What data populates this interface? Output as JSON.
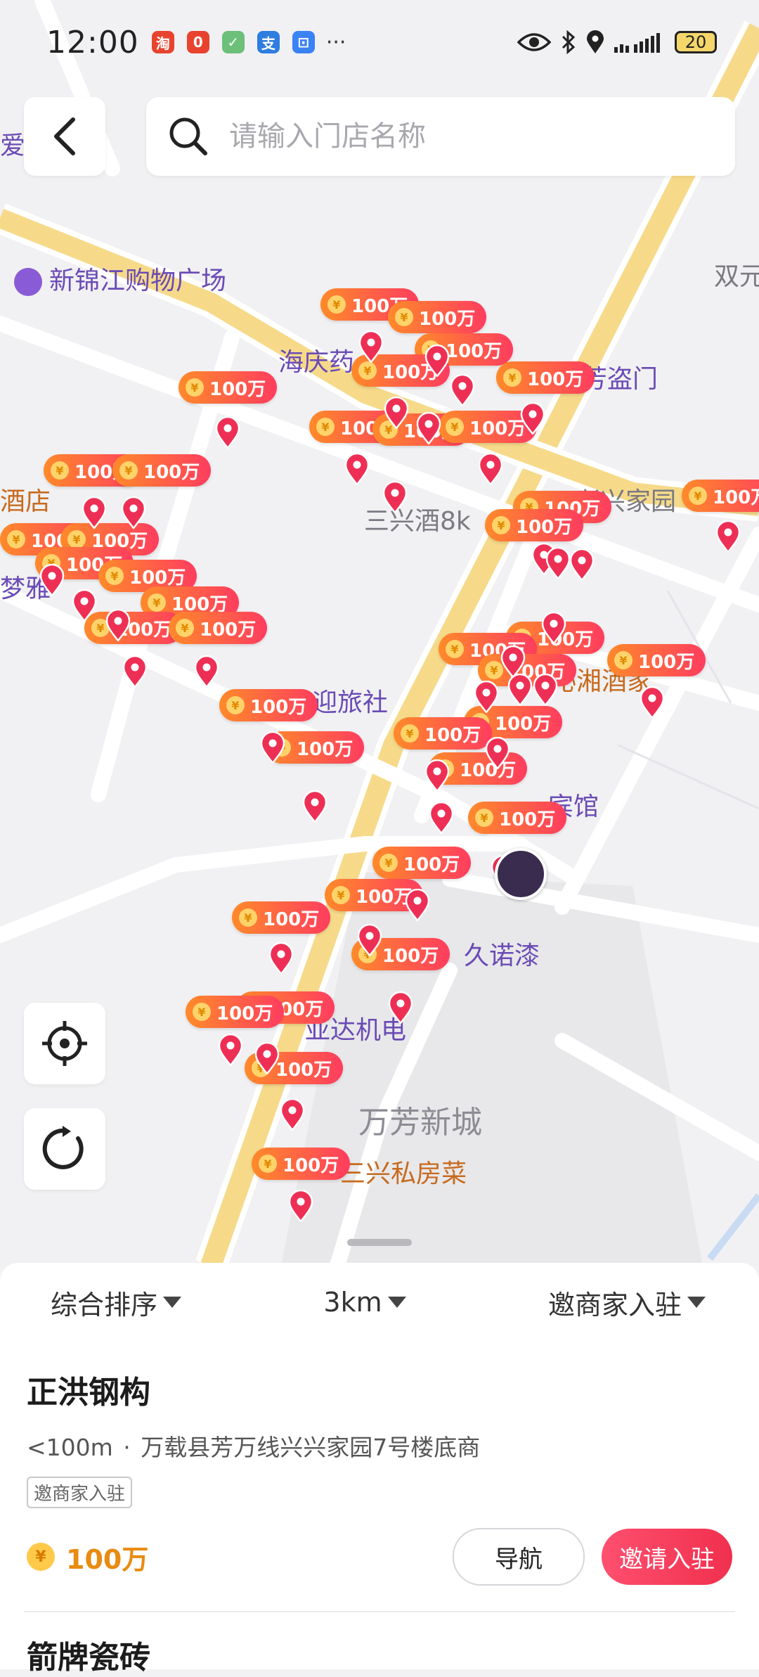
{
  "status_bar": {
    "time": "12:00",
    "notifications": [
      {
        "icon": "taobao-icon",
        "glyph": "淘",
        "color": "#e8432f"
      },
      {
        "icon": "app-red-icon",
        "glyph": "0",
        "color": "#e8432f"
      },
      {
        "icon": "shopping-bag-icon",
        "glyph": "✓",
        "color": "#6cc07a"
      },
      {
        "icon": "alipay-icon",
        "glyph": "支",
        "color": "#2f7de1"
      },
      {
        "icon": "car-icon",
        "glyph": "⊡",
        "color": "#3b82f6"
      }
    ],
    "more": "···",
    "battery": "20"
  },
  "search": {
    "placeholder": "请输入门店名称"
  },
  "map": {
    "poi_labels": [
      {
        "id": "xinjinjiang",
        "text": "新锦江购物广场",
        "style": "poi"
      },
      {
        "id": "haiqing",
        "text": "海庆药",
        "style": "poi"
      },
      {
        "id": "fangdaomen",
        "text": "芳盗门",
        "style": "poi"
      },
      {
        "id": "shuangyuan",
        "text": "双元",
        "style": "gray"
      },
      {
        "id": "xingxingjiayuan",
        "text": "兴兴家园",
        "style": "gray"
      },
      {
        "id": "sanxingjiu",
        "text": "三兴酒8k",
        "style": "gray"
      },
      {
        "id": "jiudian",
        "text": "酒店",
        "style": "orange"
      },
      {
        "id": "mengya",
        "text": "梦雅",
        "style": "poi"
      },
      {
        "id": "qinxiang",
        "text": "沁湘酒家",
        "style": "orange"
      },
      {
        "id": "lvshe",
        "text": "欢迎旅社",
        "style": "poi"
      },
      {
        "id": "binguan",
        "text": "宾馆",
        "style": "poi"
      },
      {
        "id": "jiunuoqi",
        "text": "久诺漆",
        "style": "poi"
      },
      {
        "id": "yada",
        "text": "亚达机电",
        "style": "poi"
      },
      {
        "id": "wanfang",
        "text": "万芳新城",
        "style": "big"
      },
      {
        "id": "sifangcai",
        "text": "三兴私房菜",
        "style": "orange"
      },
      {
        "id": "ai",
        "text": "爱",
        "style": "poi"
      }
    ],
    "price_tag": "100万",
    "coin_symbol": "¥",
    "pin_color": "#ee2f55"
  },
  "controls": {
    "locate": "locate-icon",
    "refresh": "refresh-icon"
  },
  "filters": [
    {
      "label": "综合排序"
    },
    {
      "label": "3km"
    },
    {
      "label": "邀商家入驻"
    }
  ],
  "shop": {
    "name": "正洪钢构",
    "distance": "<100m",
    "separator": "·",
    "address": "万载县芳万线兴兴家园7号楼底商",
    "badge": "邀商家入驻",
    "coin": "¥",
    "price": "100万",
    "nav_label": "导航",
    "invite_label": "邀请入驻"
  },
  "next_shop": {
    "name": "箭牌瓷砖"
  }
}
